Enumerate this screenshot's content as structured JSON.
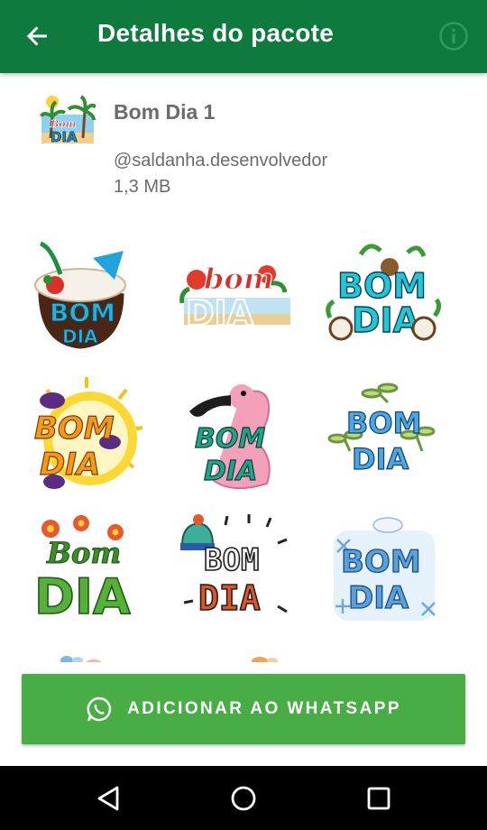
{
  "appbar": {
    "title": "Detalhes do pacote",
    "back_icon": "arrow-back-icon",
    "info_icon": "info-icon"
  },
  "pack": {
    "name": "Bom Dia 1",
    "author": "@saldanha.desenvolvedor",
    "size": "1,3 MB",
    "icon_text": [
      "Bom",
      "DIA"
    ]
  },
  "stickers": [
    {
      "line1": "BOM",
      "line2": "DIA",
      "theme": "coconut"
    },
    {
      "line1": "bom",
      "line2": "DIA",
      "theme": "beach-flowers"
    },
    {
      "line1": "BOM",
      "line2": "DIA",
      "theme": "coconuts"
    },
    {
      "line1": "BOM",
      "line2": "DIA",
      "theme": "sun-birds"
    },
    {
      "line1": "BOM",
      "line2": "DIA",
      "theme": "flamingo"
    },
    {
      "line1": "BOM",
      "line2": "DIA",
      "theme": "dragonflies"
    },
    {
      "line1": "Bom",
      "line2": "DIA",
      "theme": "flowers-grass"
    },
    {
      "line1": "BOM",
      "line2": "DIA",
      "theme": "winter-hat"
    },
    {
      "line1": "BOM",
      "line2": "DIA",
      "theme": "snowflakes"
    }
  ],
  "add_button": {
    "label": "ADICIONAR AO WHATSAPP",
    "icon": "whatsapp-icon"
  },
  "navbar": {
    "back_icon": "nav-back-icon",
    "home_icon": "nav-home-icon",
    "recents_icon": "nav-recents-icon"
  },
  "colors": {
    "appbar": "#0f7a3e",
    "button": "#49ad45",
    "info": "#2e9d5a",
    "text_muted": "#6b6b6b"
  }
}
